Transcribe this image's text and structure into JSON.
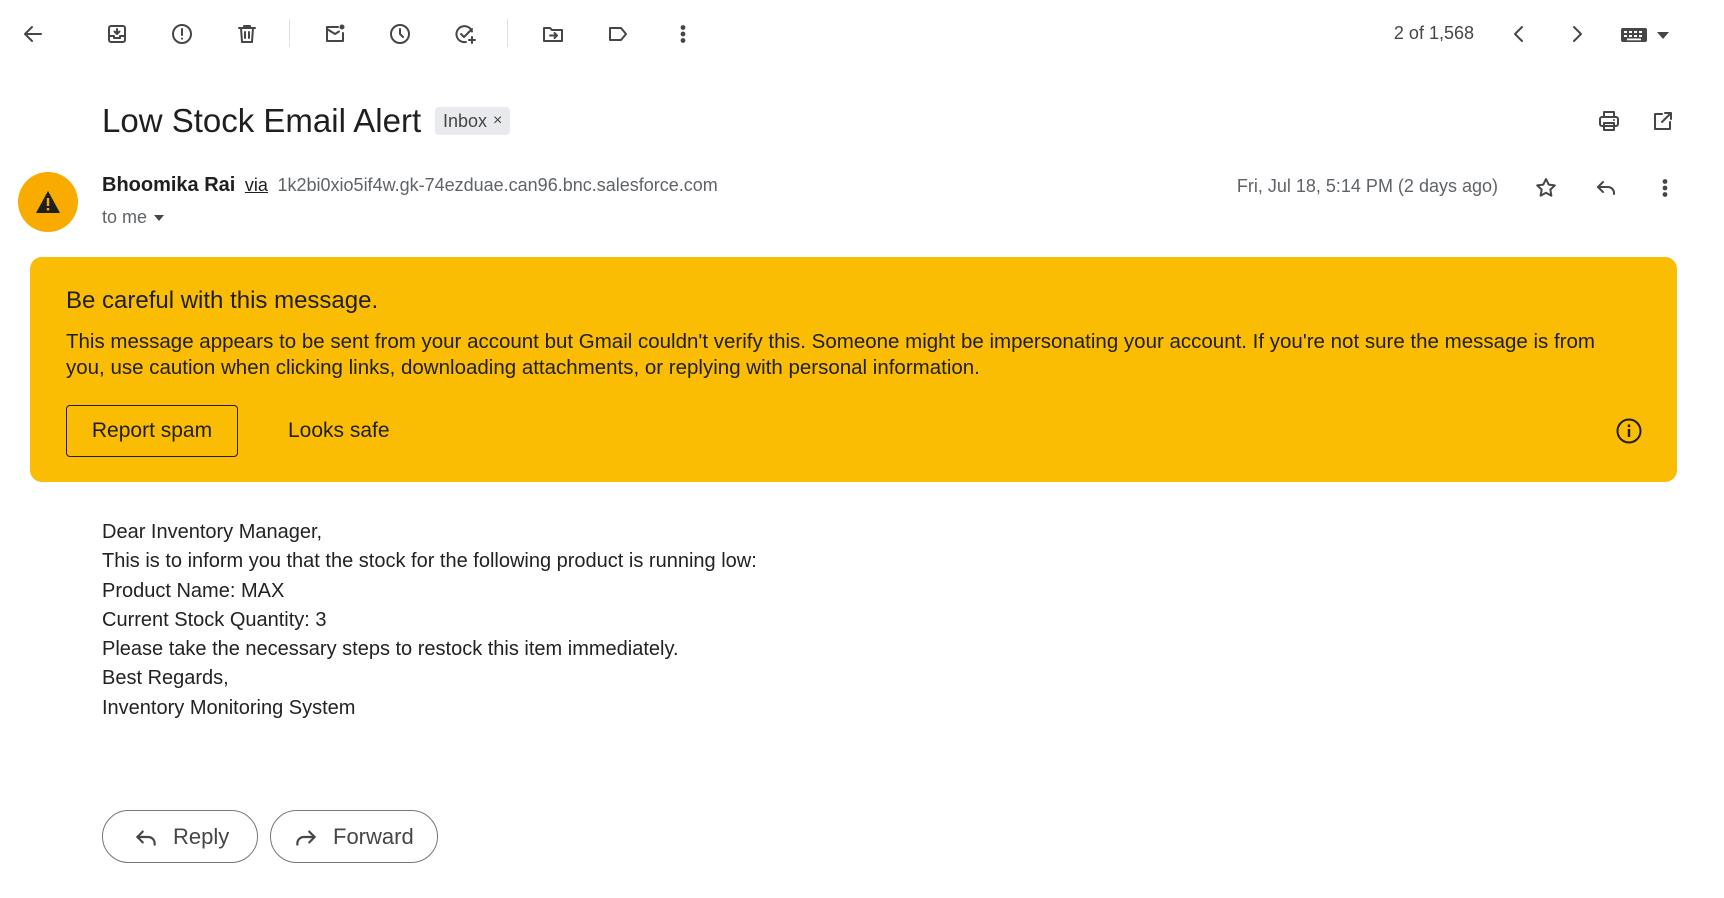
{
  "toolbar": {
    "icons": [
      "back-arrow-icon",
      "archive-icon",
      "report-spam-icon",
      "delete-icon",
      "mark-unread-icon",
      "snooze-icon",
      "add-to-tasks-icon",
      "move-to-icon",
      "label-icon",
      "more-vert-icon"
    ],
    "counter": "2 of 1,568"
  },
  "email": {
    "subject": "Low Stock Email Alert",
    "label_chip": "Inbox",
    "label_chip_close": "×",
    "sender_name": "Bhoomika Rai",
    "via": "via",
    "via_address": "1k2bi0xio5if4w.gk-74ezduae.can96.bnc.salesforce.com",
    "to": "to me",
    "date": "Fri, Jul 18, 5:14 PM (2 days ago)"
  },
  "warning": {
    "title": "Be careful with this message.",
    "body": "This message appears to be sent from your account but Gmail couldn't verify this. Someone might be impersonating your account. If you're not sure the message is from you, use caution when clicking links, downloading attachments, or replying with personal information.",
    "report_spam": "Report spam",
    "looks_safe": "Looks safe"
  },
  "body_lines": [
    "Dear Inventory Manager,",
    "This is to inform you that the stock for the following product is running low:",
    "Product Name: MAX",
    "Current Stock Quantity: 3",
    "Please take the necessary steps to restock this item immediately.",
    "Best Regards,",
    "Inventory Monitoring System"
  ],
  "actions": {
    "reply": "Reply",
    "forward": "Forward"
  },
  "colors": {
    "warning_bg": "#fbbc04",
    "avatar_bg": "#f9ab00",
    "icon": "#444746"
  }
}
